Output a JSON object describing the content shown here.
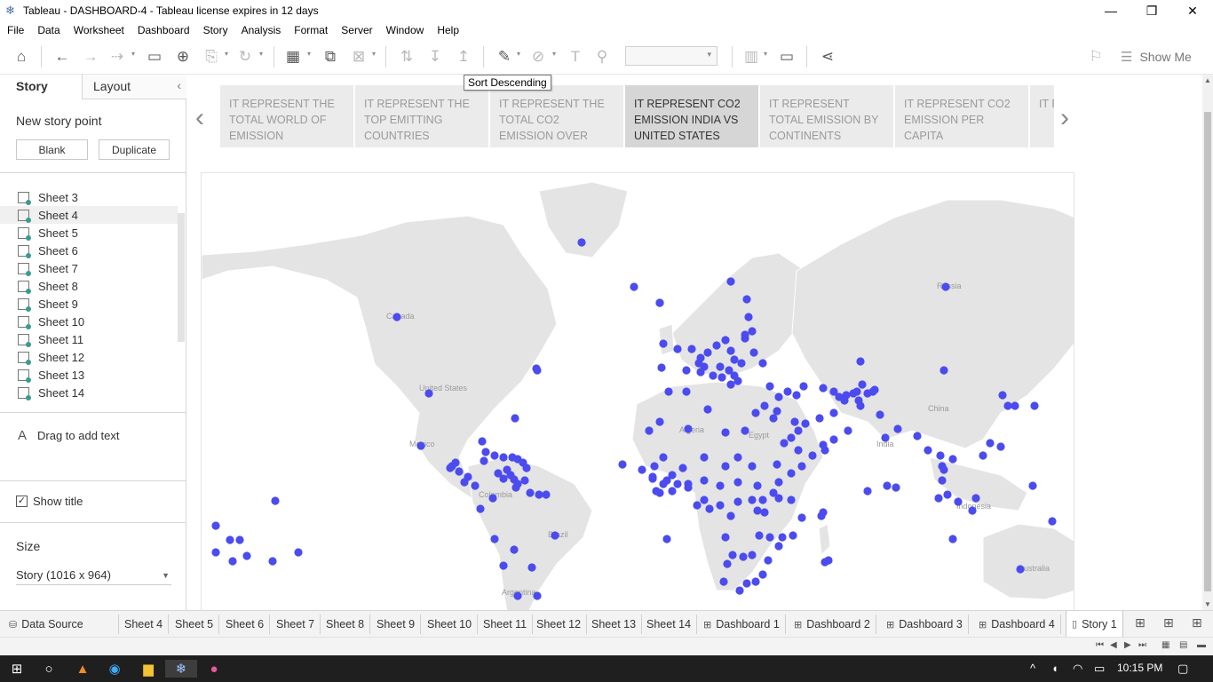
{
  "window": {
    "title": "Tableau - DASHBOARD-4 - Tableau license expires in 12 days",
    "minimize": "—",
    "restore": "❐",
    "close": "✕"
  },
  "menu": [
    "File",
    "Data",
    "Worksheet",
    "Dashboard",
    "Story",
    "Analysis",
    "Format",
    "Server",
    "Window",
    "Help"
  ],
  "toolbar": {
    "show_me": "Show Me",
    "tooltip": "Sort Descending"
  },
  "left_pane": {
    "tab_story": "Story",
    "tab_layout": "Layout",
    "collapse": "‹",
    "new_story_point": "New story point",
    "blank_btn": "Blank",
    "duplicate_btn": "Duplicate",
    "sheets": [
      "Sheet 3",
      "Sheet 4",
      "Sheet 5",
      "Sheet 6",
      "Sheet 7",
      "Sheet 8",
      "Sheet 9",
      "Sheet 10",
      "Sheet 11",
      "Sheet 12",
      "Sheet 13",
      "Sheet 14"
    ],
    "selected_sheet": "Sheet 4",
    "drag_text": "Drag to add text",
    "show_title": "Show title",
    "size_label": "Size",
    "size_value": "Story (1016 x 964)"
  },
  "story_points": [
    "IT REPRESENT THE TOTAL WORLD OF EMISSION",
    "IT REPRESENT THE TOP EMITTING COUNTRIES",
    "IT REPRESENT  THE TOTAL CO2 EMISSION OVER TIME",
    "IT REPRESENT CO2 EMISSION INDIA VS UNITED STATES",
    "IT REPRESENT TOTAL EMISSION BY CONTINENTS",
    "IT REPRESENT CO2 EMISSION PER CAPITA",
    "IT R... EMI..."
  ],
  "active_story_point": 3,
  "map": {
    "labels": {
      "canada": "Canada",
      "us": "United States",
      "mexico": "Mexico",
      "colombia": "Colombia",
      "brazil": "Brazil",
      "argentina": "Argentina",
      "russia": "Russia",
      "china": "China",
      "india": "India",
      "australia": "Australia",
      "algeria": "Algeria",
      "egypt": "Egypt",
      "indonesia": "Indonesia"
    },
    "marker_color": "#4b4bef",
    "land_color": "#e4e4e4"
  },
  "bottom_tabs": [
    "Data Source",
    "Sheet 4",
    "Sheet 5",
    "Sheet 6",
    "Sheet 7",
    "Sheet 8",
    "Sheet 9",
    "Sheet 10",
    "Sheet 11",
    "Sheet 12",
    "Sheet 13",
    "Sheet 14",
    "Dashboard 1",
    "Dashboard 2",
    "Dashboard 3",
    "Dashboard 4",
    "Story 1"
  ],
  "taskbar": {
    "time": "10:15 PM"
  }
}
